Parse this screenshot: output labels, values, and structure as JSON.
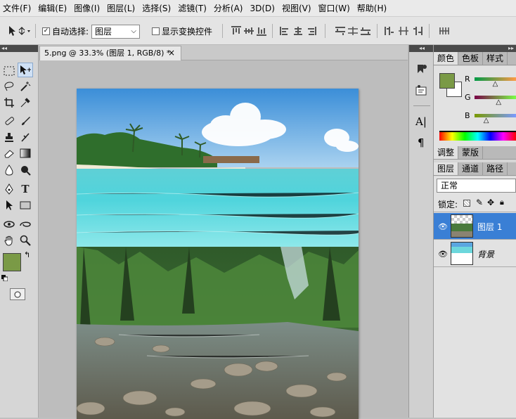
{
  "menu": [
    "文件(F)",
    "编辑(E)",
    "图像(I)",
    "图层(L)",
    "选择(S)",
    "滤镜(T)",
    "分析(A)",
    "3D(D)",
    "视图(V)",
    "窗口(W)",
    "帮助(H)"
  ],
  "options": {
    "auto_select_label": "自动选择:",
    "auto_select_checked": "✓",
    "auto_select_value": "图层",
    "show_transform_label": "显示变换控件"
  },
  "document": {
    "tab_title": "5.png @ 33.3% (图层 1, RGB/8) *",
    "close": "×"
  },
  "panels": {
    "color_tabs": [
      "颜色",
      "色板",
      "样式"
    ],
    "channels": [
      "R",
      "G",
      "B"
    ],
    "channel_levels": [
      0.52,
      0.6,
      0.3
    ],
    "fg_color": "#7a9a46",
    "bg_color": "#ffffff",
    "adjust_tabs": [
      "调整",
      "蒙版"
    ],
    "layer_tabs": [
      "图层",
      "通道",
      "路径"
    ],
    "blend_mode": "正常",
    "lock_label": "锁定:",
    "layers": [
      {
        "name": "图层 1",
        "selected": true
      },
      {
        "name": "背景",
        "selected": false
      }
    ]
  },
  "colors": {
    "accent": "#3a7fd5"
  }
}
